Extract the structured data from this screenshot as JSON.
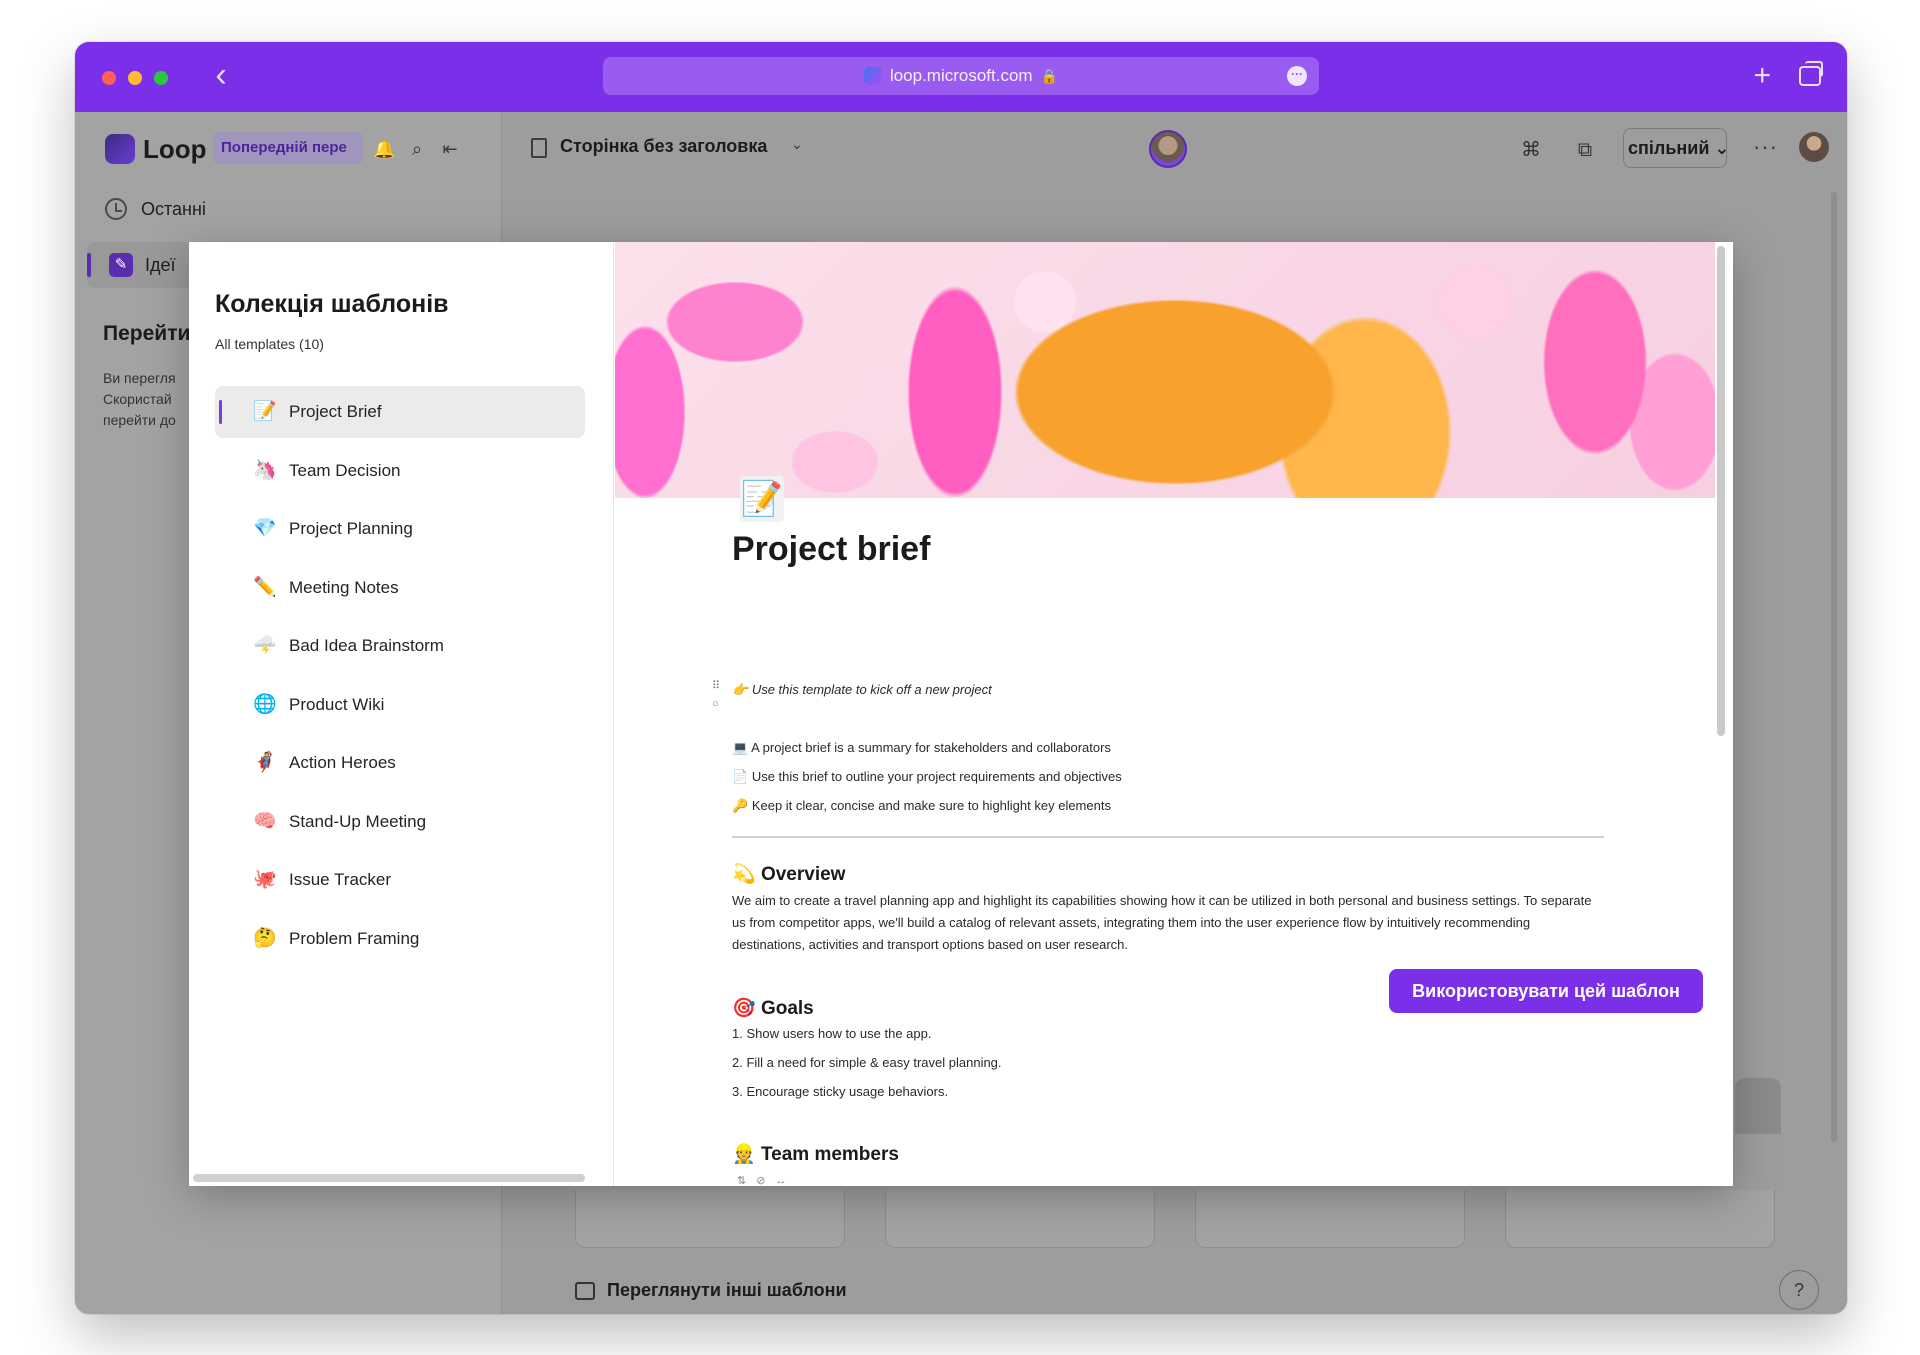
{
  "browser": {
    "url": "loop.microsoft.com"
  },
  "sidebar": {
    "app_name": "Loop",
    "preview_badge": "Попередній пере",
    "recent_label": "Останні",
    "ideas_label": "Ідеї",
    "goto_heading": "Перейти",
    "desc_lines": [
      "Ви перегля",
      "Скористай",
      "перейти до"
    ]
  },
  "topbar": {
    "page_title": "Сторінка без заголовка",
    "share_label": "спільний"
  },
  "background": {
    "browse_more_label": "Переглянути інші шаблони",
    "help_label": "?"
  },
  "modal": {
    "title": "Колекція шаблонів",
    "subtitle": "All templates (10)",
    "templates": [
      {
        "label": "Project Brief",
        "emoji": "📝",
        "active": true
      },
      {
        "label": "Team Decision",
        "emoji": "🦄",
        "active": false
      },
      {
        "label": "Project Planning",
        "emoji": "💎",
        "active": false
      },
      {
        "label": "Meeting Notes",
        "emoji": "✏️",
        "active": false
      },
      {
        "label": "Bad Idea Brainstorm",
        "emoji": "🌩️",
        "active": false
      },
      {
        "label": "Product Wiki",
        "emoji": "🌐",
        "active": false
      },
      {
        "label": "Action Heroes",
        "emoji": "🦸",
        "active": false
      },
      {
        "label": "Stand-Up Meeting",
        "emoji": "🧠",
        "active": false
      },
      {
        "label": "Issue Tracker",
        "emoji": "🐙",
        "active": false
      },
      {
        "label": "Problem Framing",
        "emoji": "🤔",
        "active": false
      }
    ],
    "use_button": "Використовувати цей шаблон",
    "close_label": "✕"
  },
  "preview": {
    "title": "Project brief",
    "intro": "Use this template to kick off a new project",
    "intro_emoji": "👉",
    "bullets": [
      {
        "emoji": "💻",
        "text": "A project brief is a summary for stakeholders and collaborators"
      },
      {
        "emoji": "📄",
        "text": "Use this brief to outline your project requirements and objectives"
      },
      {
        "emoji": "🔑",
        "text": "Keep it clear, concise and make sure to highlight key elements"
      }
    ],
    "overview_heading": "Overview",
    "overview_emoji": "💫",
    "overview_text": "We aim to create a travel planning app and highlight its capabilities showing how it can be utilized in both personal and business settings. To separate us from competitor apps, we'll build a catalog of relevant assets, integrating them into the user experience flow by intuitively recommending destinations, activities and transport options based on user research.",
    "goals_heading": "Goals",
    "goals_emoji": "🎯",
    "goals": [
      "1.   Show users how to use the app.",
      "2.   Fill a need for simple & easy travel planning.",
      "3.   Encourage sticky usage behaviors."
    ],
    "team_heading": "Team members",
    "team_emoji": "👷"
  }
}
